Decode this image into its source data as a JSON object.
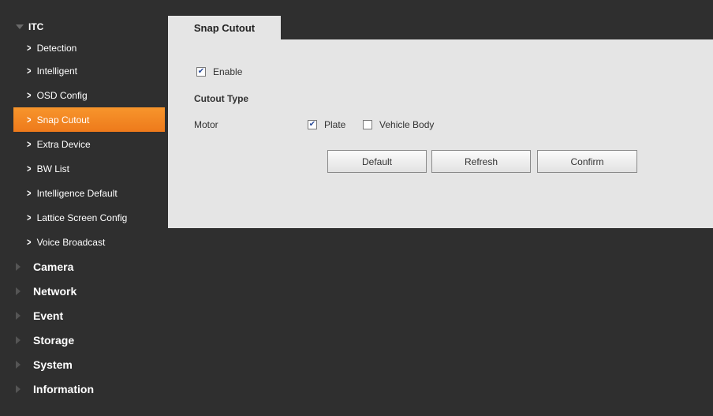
{
  "sidebar": {
    "itc_label": "ITC",
    "items": [
      {
        "label": "Detection"
      },
      {
        "label": "Intelligent"
      },
      {
        "label": "OSD Config"
      },
      {
        "label": "Snap Cutout"
      },
      {
        "label": "Extra Device"
      },
      {
        "label": "BW List"
      },
      {
        "label": "Intelligence Default"
      },
      {
        "label": "Lattice Screen Config"
      },
      {
        "label": "Voice Broadcast"
      }
    ],
    "sections": [
      {
        "label": "Camera"
      },
      {
        "label": "Network"
      },
      {
        "label": "Event"
      },
      {
        "label": "Storage"
      },
      {
        "label": "System"
      },
      {
        "label": "Information"
      }
    ],
    "active_item": "Snap Cutout",
    "active_color": "#f28a24"
  },
  "tab": {
    "label": "Snap Cutout"
  },
  "form": {
    "enable_label": "Enable",
    "enable_checked": true,
    "cutout_type_label": "Cutout Type",
    "motor_label": "Motor",
    "plate_label": "Plate",
    "plate_checked": true,
    "vehicle_body_label": "Vehicle Body",
    "vehicle_body_checked": false
  },
  "buttons": {
    "default_label": "Default",
    "refresh_label": "Refresh",
    "confirm_label": "Confirm"
  }
}
